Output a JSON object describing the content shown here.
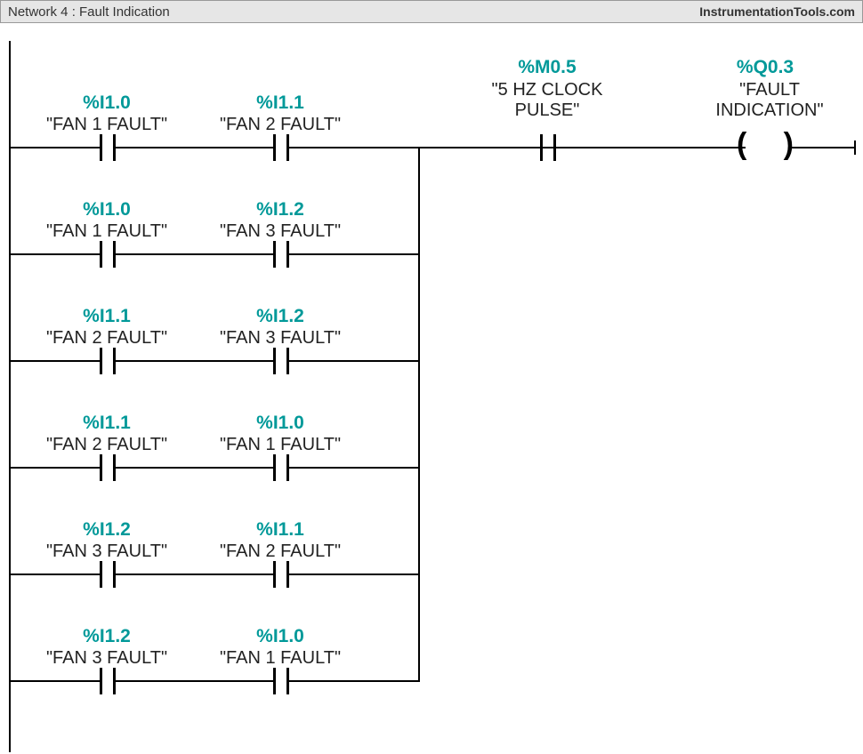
{
  "header": {
    "title": "Network 4 : Fault Indication",
    "site": "InstrumentationTools.com"
  },
  "rail": {
    "contactM05": {
      "addr": "%M0.5",
      "label": "\"5 HZ CLOCK\nPULSE\""
    },
    "coilQ03": {
      "addr": "%Q0.3",
      "label": "\"FAULT\nINDICATION\""
    }
  },
  "rungs": [
    {
      "c1": {
        "addr": "%I1.0",
        "label": "\"FAN 1 FAULT\""
      },
      "c2": {
        "addr": "%I1.1",
        "label": "\"FAN 2 FAULT\""
      }
    },
    {
      "c1": {
        "addr": "%I1.0",
        "label": "\"FAN 1 FAULT\""
      },
      "c2": {
        "addr": "%I1.2",
        "label": "\"FAN 3 FAULT\""
      }
    },
    {
      "c1": {
        "addr": "%I1.1",
        "label": "\"FAN 2 FAULT\""
      },
      "c2": {
        "addr": "%I1.2",
        "label": "\"FAN 3 FAULT\""
      }
    },
    {
      "c1": {
        "addr": "%I1.1",
        "label": "\"FAN 2 FAULT\""
      },
      "c2": {
        "addr": "%I1.0",
        "label": "\"FAN 1 FAULT\""
      }
    },
    {
      "c1": {
        "addr": "%I1.2",
        "label": "\"FAN 3 FAULT\""
      },
      "c2": {
        "addr": "%I1.1",
        "label": "\"FAN 2 FAULT\""
      }
    },
    {
      "c1": {
        "addr": "%I1.2",
        "label": "\"FAN 3 FAULT\""
      },
      "c2": {
        "addr": "%I1.0",
        "label": "\"FAN 1 FAULT\""
      }
    }
  ],
  "chart_data": {
    "type": "ladder-diagram",
    "network": 4,
    "title": "Fault Indication",
    "logic": "((I1.0 AND I1.1) OR (I1.0 AND I1.2) OR (I1.1 AND I1.2) OR (I1.1 AND I1.0) OR (I1.2 AND I1.1) OR (I1.2 AND I1.0)) AND M0.5 -> Q0.3",
    "inputs": [
      {
        "address": "%I1.0",
        "symbol": "FAN 1 FAULT"
      },
      {
        "address": "%I1.1",
        "symbol": "FAN 2 FAULT"
      },
      {
        "address": "%I1.2",
        "symbol": "FAN 3 FAULT"
      },
      {
        "address": "%M0.5",
        "symbol": "5 HZ CLOCK PULSE"
      }
    ],
    "outputs": [
      {
        "address": "%Q0.3",
        "symbol": "FAULT INDICATION",
        "type": "coil"
      }
    ],
    "parallel_branches": [
      [
        "%I1.0",
        "%I1.1"
      ],
      [
        "%I1.0",
        "%I1.2"
      ],
      [
        "%I1.1",
        "%I1.2"
      ],
      [
        "%I1.1",
        "%I1.0"
      ],
      [
        "%I1.2",
        "%I1.1"
      ],
      [
        "%I1.2",
        "%I1.0"
      ]
    ],
    "series_after_branch": [
      "%M0.5"
    ]
  }
}
